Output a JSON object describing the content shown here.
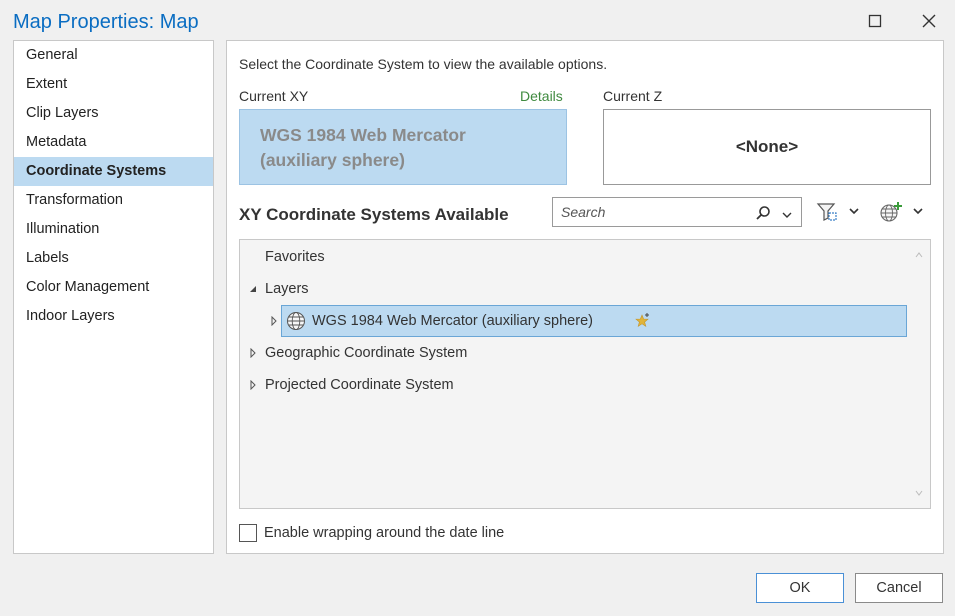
{
  "window": {
    "title": "Map Properties: Map"
  },
  "sidebar": {
    "items": [
      {
        "label": "General"
      },
      {
        "label": "Extent"
      },
      {
        "label": "Clip Layers"
      },
      {
        "label": "Metadata"
      },
      {
        "label": "Coordinate Systems",
        "selected": true
      },
      {
        "label": "Transformation"
      },
      {
        "label": "Illumination"
      },
      {
        "label": "Labels"
      },
      {
        "label": "Color Management"
      },
      {
        "label": "Indoor Layers"
      }
    ]
  },
  "main": {
    "instruction": "Select the Coordinate System to view the available options.",
    "current_xy_label": "Current XY",
    "details_link": "Details",
    "current_z_label": "Current Z",
    "current_xy_value": "WGS 1984 Web Mercator (auxiliary sphere)",
    "current_z_value": "<None>",
    "available_title": "XY Coordinate Systems Available",
    "search": {
      "placeholder": "Search",
      "value": ""
    },
    "tree": {
      "favorites": "Favorites",
      "layers": "Layers",
      "layer_item": "WGS 1984 Web Mercator (auxiliary sphere)",
      "geographic": "Geographic Coordinate System",
      "projected": "Projected Coordinate System"
    },
    "wrap_label": "Enable wrapping around the date line",
    "wrap_checked": false
  },
  "footer": {
    "ok_label": "OK",
    "cancel_label": "Cancel"
  },
  "colors": {
    "title": "#0a6dc2",
    "selection": "#bcdaf1",
    "details": "#3f8a3f",
    "favorite_star": "#d9a520"
  }
}
